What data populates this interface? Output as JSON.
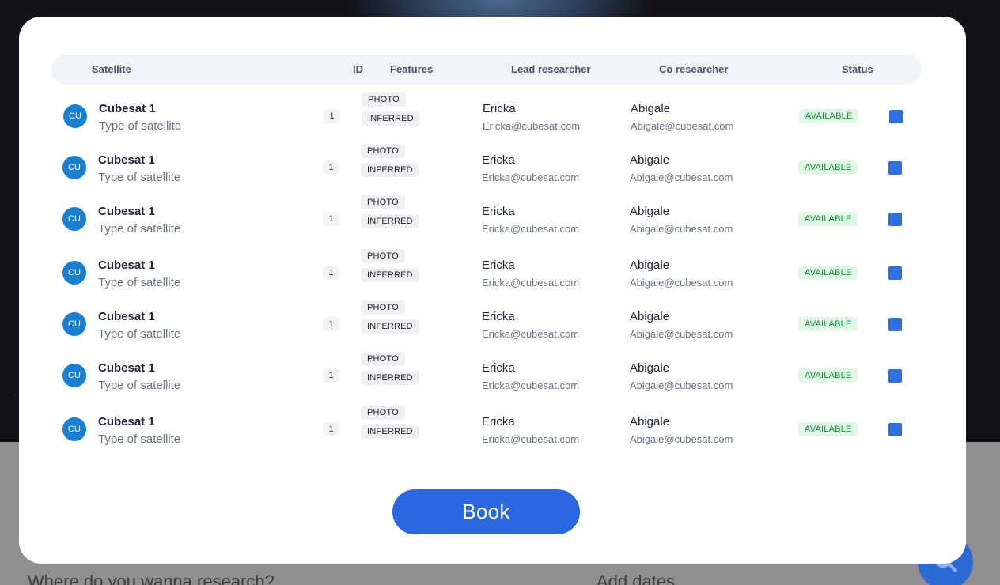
{
  "background": {
    "where_placeholder": "Where do you wanna research?",
    "dates_placeholder": "Add dates",
    "search_icon": "search-icon"
  },
  "table": {
    "headers": {
      "satellite": "Satellite",
      "id": "ID",
      "features": "Features",
      "lead": "Lead researcher",
      "co": "Co researcher",
      "status": "Status"
    },
    "rows": [
      {
        "initials": "CU",
        "name": "Cubesat 1",
        "type": "Type of satellite",
        "id": "1",
        "feature1": "PHOTO",
        "feature2": "INFERRED",
        "lead_name": "Ericka",
        "lead_email": "Ericka@cubesat.com",
        "co_name": "Abigale",
        "co_email": "Abigale@cubesat.com",
        "status": "AVAILABLE"
      },
      {
        "initials": "CU",
        "name": "Cubesat 1",
        "type": "Type of satellite",
        "id": "1",
        "feature1": "PHOTO",
        "feature2": "INFERRED",
        "lead_name": "Ericka",
        "lead_email": "Ericka@cubesat.com",
        "co_name": "Abigale",
        "co_email": "Abigale@cubesat.com",
        "status": "AVAILABLE"
      },
      {
        "initials": "CU",
        "name": "Cubesat 1",
        "type": "Type of satellite",
        "id": "1",
        "feature1": "PHOTO",
        "feature2": "INFERRED",
        "lead_name": "Ericka",
        "lead_email": "Ericka@cubesat.com",
        "co_name": "Abigale",
        "co_email": "Abigale@cubesat.com",
        "status": "AVAILABLE"
      },
      {
        "initials": "CU",
        "name": "Cubesat 1",
        "type": "Type of satellite",
        "id": "1",
        "feature1": "PHOTO",
        "feature2": "INFERRED",
        "lead_name": "Ericka",
        "lead_email": "Ericka@cubesat.com",
        "co_name": "Abigale",
        "co_email": "Abigale@cubesat.com",
        "status": "AVAILABLE"
      },
      {
        "initials": "CU",
        "name": "Cubesat 1",
        "type": "Type of satellite",
        "id": "1",
        "feature1": "PHOTO",
        "feature2": "INFERRED",
        "lead_name": "Ericka",
        "lead_email": "Ericka@cubesat.com",
        "co_name": "Abigale",
        "co_email": "Abigale@cubesat.com",
        "status": "AVAILABLE"
      },
      {
        "initials": "CU",
        "name": "Cubesat 1",
        "type": "Type of satellite",
        "id": "1",
        "feature1": "PHOTO",
        "feature2": "INFERRED",
        "lead_name": "Ericka",
        "lead_email": "Ericka@cubesat.com",
        "co_name": "Abigale",
        "co_email": "Abigale@cubesat.com",
        "status": "AVAILABLE"
      },
      {
        "initials": "CU",
        "name": "Cubesat 1",
        "type": "Type of satellite",
        "id": "1",
        "feature1": "PHOTO",
        "feature2": "INFERRED",
        "lead_name": "Ericka",
        "lead_email": "Ericka@cubesat.com",
        "co_name": "Abigale",
        "co_email": "Abigale@cubesat.com",
        "status": "AVAILABLE"
      }
    ]
  },
  "actions": {
    "book_label": "Book"
  },
  "colors": {
    "accent": "#2b67e1",
    "avatar": "#1a7fd1",
    "status_bg": "#e0f7e6",
    "status_text": "#128a3a"
  }
}
